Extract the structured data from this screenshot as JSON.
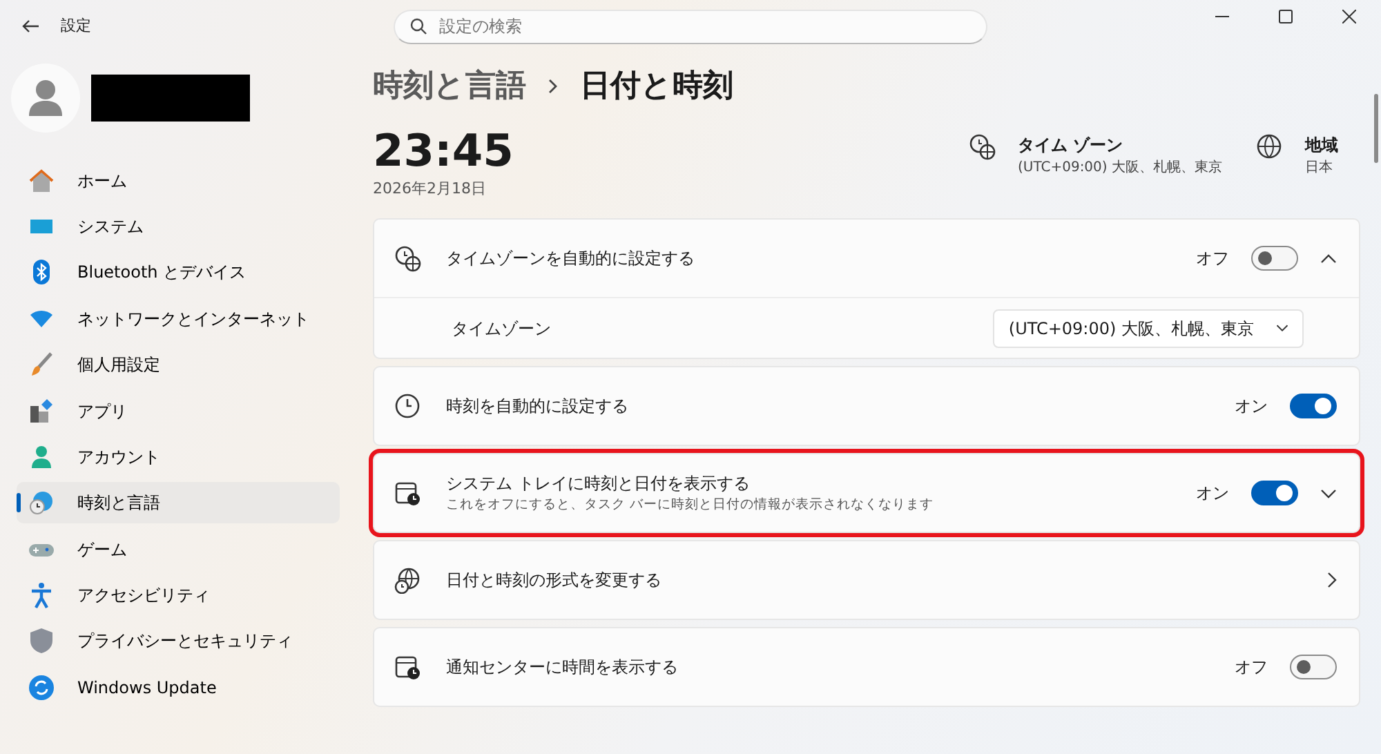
{
  "window": {
    "title": "設定"
  },
  "search": {
    "placeholder": "設定の検索"
  },
  "sidebar": {
    "items": [
      {
        "kind": "home",
        "label": "ホーム",
        "selected": false
      },
      {
        "kind": "system",
        "label": "システム",
        "selected": false
      },
      {
        "kind": "bluetooth",
        "label": "Bluetooth とデバイス",
        "selected": false
      },
      {
        "kind": "wifi",
        "label": "ネットワークとインターネット",
        "selected": false
      },
      {
        "kind": "brush",
        "label": "個人用設定",
        "selected": false
      },
      {
        "kind": "apps",
        "label": "アプリ",
        "selected": false
      },
      {
        "kind": "account",
        "label": "アカウント",
        "selected": false
      },
      {
        "kind": "time",
        "label": "時刻と言語",
        "selected": true
      },
      {
        "kind": "game",
        "label": "ゲーム",
        "selected": false
      },
      {
        "kind": "accessibility",
        "label": "アクセシビリティ",
        "selected": false
      },
      {
        "kind": "shield",
        "label": "プライバシーとセキュリティ",
        "selected": false
      },
      {
        "kind": "update",
        "label": "Windows Update",
        "selected": false
      }
    ]
  },
  "breadcrumb": {
    "parent": "時刻と言語",
    "current": "日付と時刻"
  },
  "clock": {
    "time": "23:45",
    "date": "2026年2月18日"
  },
  "summary": [
    {
      "kind": "timezone",
      "title": "タイム ゾーン",
      "value": "(UTC+09:00) 大阪、札幌、東京"
    },
    {
      "kind": "region",
      "title": "地域",
      "value": "日本"
    }
  ],
  "settings": [
    {
      "kind": "toggle",
      "label": "タイムゾーンを自動的に設定する",
      "state_label": "オフ",
      "on": false,
      "expanded": true,
      "children": [
        {
          "kind": "dropdown",
          "label": "タイムゾーン",
          "value": "(UTC+09:00) 大阪、札幌、東京"
        }
      ]
    },
    {
      "kind": "toggle",
      "label": "時刻を自動的に設定する",
      "state_label": "オン",
      "on": true
    },
    {
      "kind": "toggle",
      "label": "システム トレイに時刻と日付を表示する",
      "description": "これをオフにすると、タスク バーに時刻と日付の情報が表示されなくなります",
      "state_label": "オン",
      "on": true,
      "expanded": false,
      "highlighted": true
    },
    {
      "kind": "link",
      "label": "日付と時刻の形式を変更する"
    },
    {
      "kind": "toggle",
      "label": "通知センターに時間を表示する",
      "state_label": "オフ",
      "on": false
    }
  ]
}
